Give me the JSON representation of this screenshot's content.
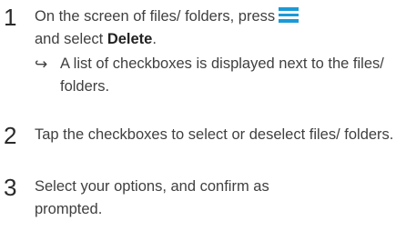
{
  "steps": [
    {
      "number": "1",
      "text_before": "On the screen of files/ folders, press",
      "text_select": "and select",
      "bold_word": "Delete",
      "text_after": ".",
      "icon": "menu-icon",
      "icon_color": "#1a9ad6",
      "result_arrow": "↪",
      "result_text": "A list of checkboxes is displayed next to the files/ folders."
    },
    {
      "number": "2",
      "text": "Tap the checkboxes to select or deselect files/ folders."
    },
    {
      "number": "3",
      "text": "Select your options, and confirm as prompted."
    }
  ]
}
